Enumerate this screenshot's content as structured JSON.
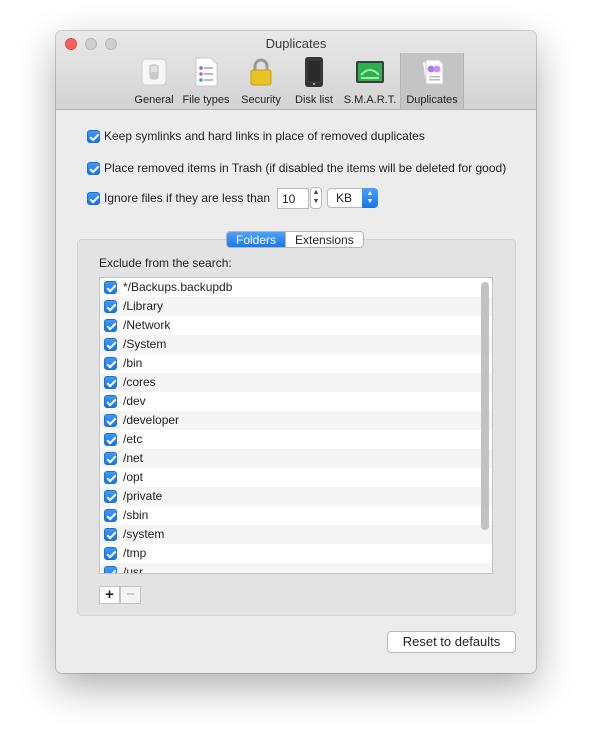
{
  "window": {
    "title": "Duplicates"
  },
  "tabs": [
    {
      "label": "General",
      "icon": "toggle-switch-icon"
    },
    {
      "label": "File types",
      "icon": "document-list-icon"
    },
    {
      "label": "Security",
      "icon": "lock-icon"
    },
    {
      "label": "Disk list",
      "icon": "hard-drive-icon"
    },
    {
      "label": "S.M.A.R.T.",
      "icon": "gauge-icon"
    },
    {
      "label": "Duplicates",
      "icon": "duplicate-files-icon",
      "selected": true
    }
  ],
  "options": {
    "keep_links": {
      "label": "Keep symlinks and hard links in place of removed duplicates",
      "checked": true
    },
    "trash": {
      "label": "Place removed items in Trash (if disabled the items will be deleted for good)",
      "checked": true
    },
    "ignore_small": {
      "label": "Ignore files if they are less than",
      "checked": true,
      "size_value": "10",
      "unit": "KB"
    }
  },
  "segments": {
    "folders": "Folders",
    "extensions": "Extensions",
    "selected": "Folders"
  },
  "exclude_label": "Exclude from the search:",
  "excluded_folders": [
    "*/Backups.backupdb",
    "/Library",
    "/Network",
    "/System",
    "/bin",
    "/cores",
    "/dev",
    "/developer",
    "/etc",
    "/net",
    "/opt",
    "/private",
    "/sbin",
    "/system",
    "/tmp",
    "/usr"
  ],
  "buttons": {
    "add": "+",
    "remove": "−",
    "reset": "Reset to defaults"
  },
  "colors": {
    "accent": "#1a77ea",
    "close": "#fc615d"
  }
}
